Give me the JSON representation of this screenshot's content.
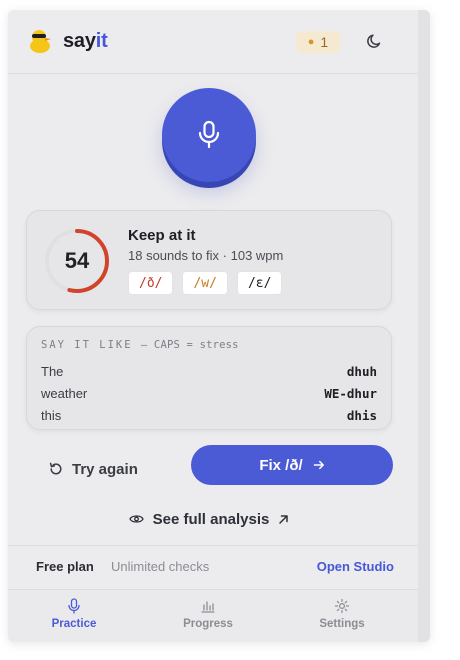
{
  "header": {
    "brand_part1": "say",
    "brand_part2": "it",
    "streak_count": "1"
  },
  "score": {
    "value": "54",
    "fraction": 0.54,
    "title": "Keep at it",
    "subtitle": "18 sounds to fix · 103 wpm",
    "chips": [
      {
        "text": "/ð/",
        "color": "#c0392b"
      },
      {
        "text": "/w/",
        "color": "#c77a1e"
      },
      {
        "text": "/ɛ/",
        "color": "#1e1f24"
      }
    ]
  },
  "say_it_like": {
    "heading": "SAY IT LIKE",
    "note": "— CAPS = stress",
    "rows": [
      {
        "word": "The",
        "phonetic": "dhuh"
      },
      {
        "word": "weather",
        "phonetic": "WE-dhur"
      },
      {
        "word": "this",
        "phonetic": "dhis"
      }
    ]
  },
  "actions": {
    "try_again": "Try again",
    "fix": "Fix /ð/",
    "see_analysis": "See full analysis"
  },
  "plan": {
    "name": "Free plan",
    "description": "Unlimited checks",
    "open_studio": "Open Studio"
  },
  "nav": {
    "practice": "Practice",
    "progress": "Progress",
    "settings": "Settings"
  },
  "colors": {
    "accent": "#4b5bd6",
    "ring": "#d0442c"
  }
}
